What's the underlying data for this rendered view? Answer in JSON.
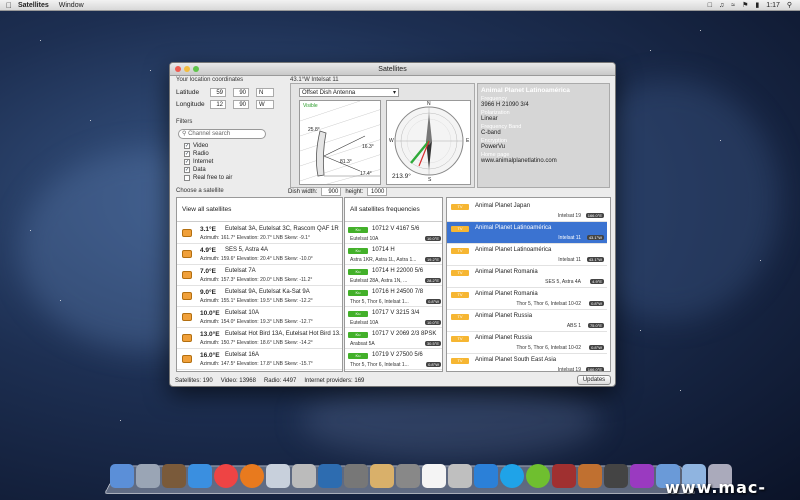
{
  "menubar": {
    "app_name": "Satellites",
    "menus": [
      "Window"
    ],
    "clock": "1:17"
  },
  "window": {
    "title": "Satellites",
    "sat_position_caption": "43.1°W Intelsat 11",
    "location": {
      "heading": "Your location coordinates",
      "latitude_label": "Latitude",
      "latitude_deg": "59",
      "latitude_min": "90",
      "latitude_dir": "N",
      "longitude_label": "Longitude",
      "longitude_deg": "12",
      "longitude_min": "90",
      "longitude_dir": "W"
    },
    "filters": {
      "heading": "Filters",
      "search_placeholder": "Channel search",
      "items": [
        {
          "label": "Video",
          "checked": true
        },
        {
          "label": "Radio",
          "checked": true
        },
        {
          "label": "Internet",
          "checked": true
        },
        {
          "label": "Data",
          "checked": true
        },
        {
          "label": "Real free to air",
          "checked": false
        }
      ]
    },
    "dish": {
      "antenna_type": "Offset Dish Antenna",
      "visible_label": "Visible",
      "angle_1": "25.8°",
      "angle_2": "81.3°",
      "angle_3": "17.4°",
      "angle_4": "16.3°",
      "azimuth_reading": "213.9°",
      "compass_n": "N",
      "compass_s": "S",
      "compass_e": "E",
      "compass_w": "W",
      "width_label": "Dish width:",
      "width_value": "900",
      "height_label": "height:",
      "height_value": "1000"
    },
    "info": {
      "channel_name": "Animal Planet Latinoamérica",
      "frequency_label": "Frequency",
      "frequency_value": "3966 H 21090 3/4",
      "polarization_label": "Polarization",
      "polarization_value": "Linear",
      "band_label": "Frequency Band",
      "band_value": "C-band",
      "encryption_label": "Encryption",
      "encryption_value": "PowerVu",
      "homepage_label": "Home page",
      "homepage_value": "www.animalplanetlatino.com"
    },
    "choose_satellite_label": "Choose a satellite",
    "satellites_header": "View all satellites",
    "satellites": [
      {
        "pos": "3.1°E",
        "names": "Eutelsat 3A, Eutelsat 3C, Rascom QAF 1R",
        "detail": "Azimuth: 161.7°   Elevation: 20.7°   LNB Skew: -9.1°"
      },
      {
        "pos": "4.9°E",
        "names": "SES 5, Astra 4A",
        "detail": "Azimuth: 159.6°   Elevation: 20.4°   LNB Skew: -10.0°"
      },
      {
        "pos": "7.0°E",
        "names": "Eutelsat 7A",
        "detail": "Azimuth: 157.3°   Elevation: 20.0°   LNB Skew: -11.2°"
      },
      {
        "pos": "9.0°E",
        "names": "Eutelsat 9A, Eutelsat Ka-Sat 9A",
        "detail": "Azimuth: 155.1°   Elevation: 19.5°   LNB Skew: -12.2°"
      },
      {
        "pos": "10.0°E",
        "names": "Eutelsat 10A",
        "detail": "Azimuth: 154.0°   Elevation: 19.3°   LNB Skew: -12.7°"
      },
      {
        "pos": "13.0°E",
        "names": "Eutelsat Hot Bird 13A, Eutelsat Hot Bird 13...",
        "detail": "Azimuth: 150.7°   Elevation: 18.6°   LNB Skew: -14.2°"
      },
      {
        "pos": "16.0°E",
        "names": "Eutelsat 16A",
        "detail": "Azimuth: 147.5°   Elevation: 17.8°   LNB Skew: -15.7°"
      }
    ],
    "frequencies_header": "All satellites frequencies",
    "frequencies": [
      {
        "tag": "Ku",
        "value": "10712 V 4167 5/6",
        "sat": "Eutelsat 10A",
        "badge": "10.0°E"
      },
      {
        "tag": "Ku",
        "value": "10714 H",
        "sat": "Astra 1KR, Astra 1L, Astra 1...",
        "badge": "19.2°E"
      },
      {
        "tag": "Ku",
        "value": "10714 H 22000 5/6",
        "sat": "Eutelsat 28A, Astra 1N, ...",
        "badge": "28.2°E"
      },
      {
        "tag": "Ku",
        "value": "10716 H 24500 7/8",
        "sat": "Thor 5, Thor 6, Intelsat 1...",
        "badge": "0.8°W"
      },
      {
        "tag": "Ku",
        "value": "10717 V 3215 3/4",
        "sat": "Eutelsat 10A",
        "badge": "10.0°E"
      },
      {
        "tag": "Ku",
        "value": "10717 V 2069 2/3 8PSK",
        "sat": "Arabsat 5A",
        "badge": "30.5°E"
      },
      {
        "tag": "Ku",
        "value": "10719 V 27500 5/6",
        "sat": "Thor 5, Thor 6, Intelsat 1...",
        "badge": "0.8°W"
      }
    ],
    "channels": [
      {
        "tag": "TV",
        "name": "Animal Planet Japan",
        "sat": "Intelsat 19",
        "badge": "166.0°E",
        "selected": false
      },
      {
        "tag": "TV",
        "name": "Animal Planet Latinoamérica",
        "sat": "Intelsat 11",
        "badge": "43.1°W",
        "selected": true
      },
      {
        "tag": "TV",
        "name": "Animal Planet Latinoamérica",
        "sat": "Intelsat 11",
        "badge": "43.1°W",
        "selected": false
      },
      {
        "tag": "TV",
        "name": "Animal Planet Romania",
        "sat": "SES 5, Astra 4A",
        "badge": "4.9°E",
        "selected": false
      },
      {
        "tag": "TV",
        "name": "Animal Planet Romania",
        "sat": "Thor 5, Thor 6, Intelsat 10-02",
        "badge": "0.8°W",
        "selected": false
      },
      {
        "tag": "TV",
        "name": "Animal Planet Russia",
        "sat": "ABS 1",
        "badge": "75.0°E",
        "selected": false
      },
      {
        "tag": "TV",
        "name": "Animal Planet Russia",
        "sat": "Thor 5, Thor 6, Intelsat 10-02",
        "badge": "0.8°W",
        "selected": false
      },
      {
        "tag": "TV",
        "name": "Animal Planet South East Asia",
        "sat": "Intelsat 19",
        "badge": "166.0°E",
        "selected": false
      }
    ],
    "status": {
      "satellites": "Satellites: 190",
      "video": "Video: 13968",
      "radio": "Radio: 4497",
      "internet": "Internet providers: 169"
    },
    "updates_button": "Updates"
  },
  "watermark": "www.mac-gm.com",
  "colors": {
    "selection": "#3b73d1",
    "ku_tag": "#43b02a",
    "tv_tag": "#f6b632"
  }
}
